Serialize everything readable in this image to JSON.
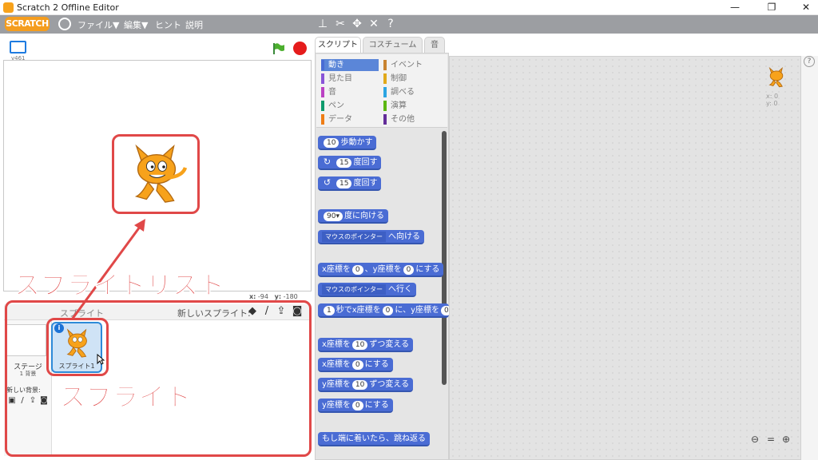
{
  "window": {
    "title": "Scratch 2 Offline Editor",
    "controls": [
      "—",
      "❐",
      "✕"
    ]
  },
  "menubar": {
    "logo": "SCRATCH",
    "items": [
      "ファイル▼",
      "編集▼",
      "ヒント",
      "説明"
    ],
    "tool_icons": [
      "duplicate-icon",
      "delete-icon",
      "grow-icon",
      "shrink-icon",
      "help-icon"
    ]
  },
  "stage": {
    "version": "v461",
    "coords": {
      "x_label": "x:",
      "x_value": "-94",
      "y_label": "y:",
      "y_value": "-180"
    }
  },
  "sprite_pane": {
    "title": "スプライト",
    "new_sprite_label": "新しいスプライト:",
    "stage_name": "ステージ",
    "stage_backdrops": "1 背景",
    "new_backdrop_label": "新しい背景:",
    "sprite_name": "スプライト1"
  },
  "annotations": {
    "sprite_list": "スプライトリスト",
    "sprite": "スプライト"
  },
  "tabs": [
    "スクリプト",
    "コスチューム",
    "音"
  ],
  "categories": [
    {
      "label": "動き",
      "color": "#4a6cd4",
      "active": true
    },
    {
      "label": "イベント",
      "color": "#c88330"
    },
    {
      "label": "見た目",
      "color": "#8a55d7"
    },
    {
      "label": "制御",
      "color": "#e1a91a"
    },
    {
      "label": "音",
      "color": "#bb42c3"
    },
    {
      "label": "調べる",
      "color": "#2ca5e2"
    },
    {
      "label": "ペン",
      "color": "#0e9a6c"
    },
    {
      "label": "演算",
      "color": "#5cb712"
    },
    {
      "label": "データ",
      "color": "#ee7d16"
    },
    {
      "label": "その他",
      "color": "#632d99"
    }
  ],
  "blocks": {
    "move": {
      "value": "10",
      "text": "歩動かす"
    },
    "turn_right": {
      "value": "15",
      "text": "度回す"
    },
    "turn_left": {
      "value": "15",
      "text": "度回す"
    },
    "point_dir": {
      "value": "90▾",
      "text": "度に向ける"
    },
    "point_towards": {
      "menu": "マウスのポインター",
      "text": "へ向ける"
    },
    "goto_xy": {
      "a": "x座標を",
      "x": "0",
      "b": "、y座標を",
      "y": "0",
      "c": "にする"
    },
    "goto": {
      "menu": "マウスのポインター",
      "text": "へ行く"
    },
    "glide": {
      "secs": "1",
      "a": "秒でx座標を",
      "x": "0",
      "b": "に、y座標を",
      "y": "0"
    },
    "change_x": {
      "a": "x座標を",
      "v": "10",
      "b": "ずつ変える"
    },
    "set_x": {
      "a": "x座標を",
      "v": "0",
      "b": "にする"
    },
    "change_y": {
      "a": "y座標を",
      "v": "10",
      "b": "ずつ変える"
    },
    "set_y": {
      "a": "y座標を",
      "v": "0",
      "b": "にする"
    },
    "bounce": {
      "text": "もし端に着いたら、跳ね返る"
    }
  },
  "scripts": {
    "xy": {
      "x": "x: 0",
      "y": "y: 0"
    }
  },
  "zoom_icons": [
    "zoom-out-icon",
    "zoom-reset-icon",
    "zoom-in-icon"
  ]
}
